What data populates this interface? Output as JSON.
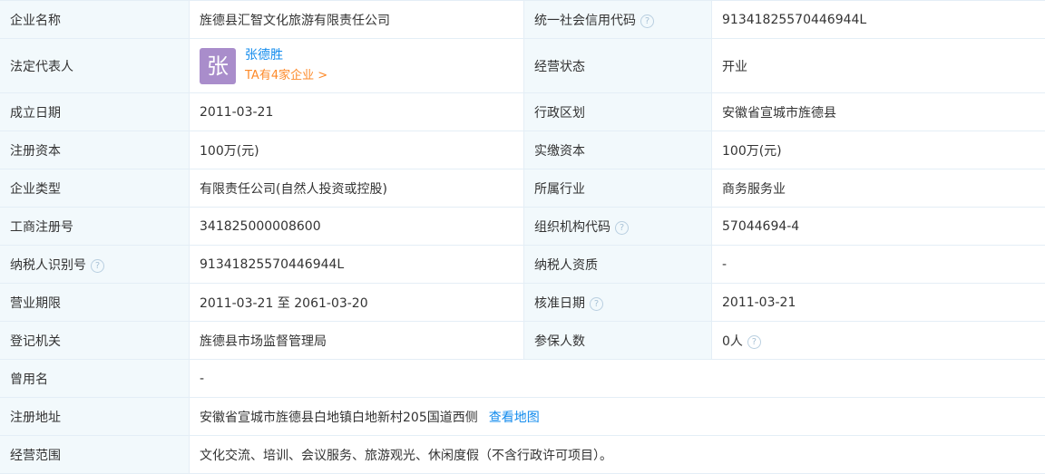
{
  "rows": [
    {
      "l1": "企业名称",
      "v1": "旌德县汇智文化旅游有限责任公司",
      "l2": "统一社会信用代码",
      "v2": "91341825570446944L"
    },
    {
      "l1": "法定代表人",
      "avatar_char": "张",
      "rep_name": "张德胜",
      "rep_link": "TA有4家企业 >",
      "l2": "经营状态",
      "v2": "开业"
    },
    {
      "l1": "成立日期",
      "v1": "2011-03-21",
      "l2": "行政区划",
      "v2": "安徽省宣城市旌德县"
    },
    {
      "l1": "注册资本",
      "v1": "100万(元)",
      "l2": "实缴资本",
      "v2": "100万(元)"
    },
    {
      "l1": "企业类型",
      "v1": "有限责任公司(自然人投资或控股)",
      "l2": "所属行业",
      "v2": "商务服务业"
    },
    {
      "l1": "工商注册号",
      "v1": "341825000008600",
      "l2": "组织机构代码",
      "v2": "57044694-4"
    },
    {
      "l1": "纳税人识别号",
      "v1": "91341825570446944L",
      "l2": "纳税人资质",
      "v2": "-"
    },
    {
      "l1": "营业期限",
      "v1": "2011-03-21 至 2061-03-20",
      "l2": "核准日期",
      "v2": "2011-03-21"
    },
    {
      "l1": "登记机关",
      "v1": "旌德县市场监督管理局",
      "l2": "参保人数",
      "v2": "0人"
    },
    {
      "l1": "曾用名",
      "v1": "-"
    },
    {
      "l1": "注册地址",
      "v1": "安徽省宣城市旌德县白地镇白地新村205国道西侧",
      "link": "查看地图"
    },
    {
      "l1": "经营范围",
      "v1": "文化交流、培训、会议服务、旅游观光、休闲度假（不含行政许可项目）。"
    }
  ],
  "help_icon_glyph": "?",
  "colors": {
    "label_bg": "#f2f9fc",
    "border": "#e4eef6",
    "link_blue": "#128bed",
    "link_orange": "#fd8a2a",
    "avatar_bg": "#a98dcb"
  }
}
